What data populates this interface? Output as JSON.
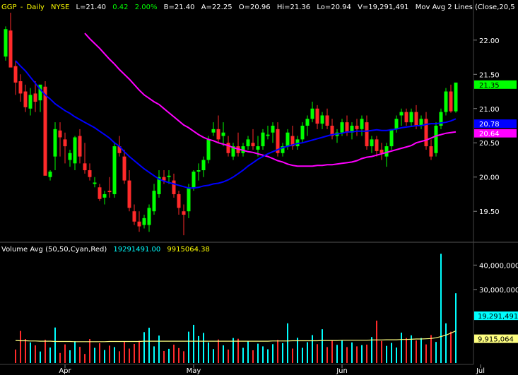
{
  "header": {
    "symbol": "GGP",
    "period": "Daily",
    "exchange": "NYSE",
    "last": "L=21.40",
    "change": "0.42",
    "change_pct": "2.00%",
    "bid": "B=21.40",
    "ask": "A=22.25",
    "open": "O=20.96",
    "high": "Hi=21.36",
    "low": "Lo=20.94",
    "volume": "V=19,291,491",
    "study": "Mov Avg 2 Lines (Close,20,5"
  },
  "volume_header": {
    "label": "Volume Avg (50,50,Cyan,Red)",
    "value1": "19291491.00",
    "value2": "9915064.38"
  },
  "chart_data": [
    {
      "type": "candlestick",
      "title": "GGP - Daily  NYSE",
      "ylim": [
        19.1,
        22.4
      ],
      "yticks": [
        "22.00",
        "21.50",
        "21.00",
        "20.50",
        "20.00",
        "19.50"
      ],
      "ytick_values": [
        22.0,
        21.5,
        21.0,
        20.5,
        20.0,
        19.5
      ],
      "xticks": [
        "Apr",
        "May",
        "Jun",
        "Jul"
      ],
      "xtick_index": [
        12,
        38,
        68,
        96
      ],
      "grid": false,
      "colors": {
        "up": "#00ff00",
        "down": "#ff2a2a",
        "ma_fast": "#0000ff",
        "ma_slow": "#ff00ff"
      },
      "candles": [
        [
          21.76,
          22.2,
          21.7,
          22.16
        ],
        [
          22.14,
          22.4,
          21.85,
          21.6
        ],
        [
          21.62,
          21.7,
          21.2,
          21.38
        ],
        [
          21.4,
          21.5,
          21.1,
          21.22
        ],
        [
          21.25,
          21.35,
          20.95,
          21.02
        ],
        [
          21.0,
          21.3,
          20.9,
          21.2
        ],
        [
          21.22,
          21.4,
          20.95,
          21.1
        ],
        [
          21.12,
          21.25,
          20.95,
          21.35
        ],
        [
          21.32,
          21.4,
          20.6,
          20.02
        ],
        [
          20.0,
          20.1,
          19.95,
          20.08
        ],
        [
          20.3,
          20.8,
          20.1,
          20.7
        ],
        [
          20.68,
          20.8,
          20.3,
          20.58
        ],
        [
          20.55,
          20.65,
          20.2,
          20.45
        ],
        [
          20.25,
          20.4,
          20.15,
          20.35
        ],
        [
          20.2,
          20.6,
          20.1,
          20.58
        ],
        [
          20.6,
          20.7,
          20.2,
          20.3
        ],
        [
          20.2,
          20.5,
          20.05,
          20.1
        ],
        [
          20.1,
          20.2,
          19.95,
          20.0
        ],
        [
          19.9,
          20.0,
          19.85,
          19.92
        ],
        [
          19.85,
          19.9,
          19.65,
          19.68
        ],
        [
          19.7,
          19.8,
          19.6,
          19.75
        ],
        [
          19.8,
          20.0,
          19.7,
          19.78
        ],
        [
          19.75,
          20.5,
          19.7,
          20.45
        ],
        [
          20.45,
          20.6,
          20.3,
          20.35
        ],
        [
          20.3,
          20.4,
          19.9,
          19.95
        ],
        [
          19.95,
          20.1,
          19.5,
          19.55
        ],
        [
          19.5,
          19.6,
          19.3,
          19.35
        ],
        [
          19.35,
          19.5,
          19.2,
          19.28
        ],
        [
          19.3,
          19.45,
          19.25,
          19.4
        ],
        [
          19.3,
          19.6,
          19.2,
          19.55
        ],
        [
          19.5,
          19.9,
          19.45,
          19.8
        ],
        [
          19.75,
          20.1,
          19.7,
          20.0
        ],
        [
          20.0,
          20.1,
          19.9,
          19.95
        ],
        [
          20.0,
          20.1,
          19.9,
          20.02
        ],
        [
          19.95,
          20.05,
          19.7,
          19.75
        ],
        [
          19.75,
          19.8,
          19.45,
          19.55
        ],
        [
          19.5,
          19.6,
          19.15,
          19.45
        ],
        [
          19.5,
          19.9,
          19.4,
          19.85
        ],
        [
          19.85,
          20.1,
          19.8,
          20.08
        ],
        [
          20.08,
          20.2,
          19.95,
          20.1
        ],
        [
          20.1,
          20.3,
          20.0,
          20.25
        ],
        [
          20.25,
          20.6,
          20.2,
          20.55
        ],
        [
          20.65,
          20.8,
          20.6,
          20.7
        ],
        [
          20.7,
          20.9,
          20.5,
          20.55
        ],
        [
          20.6,
          20.8,
          20.45,
          20.65
        ],
        [
          20.5,
          20.6,
          20.3,
          20.35
        ],
        [
          20.3,
          20.5,
          20.25,
          20.45
        ],
        [
          20.45,
          20.65,
          20.3,
          20.35
        ],
        [
          20.35,
          20.5,
          20.3,
          20.45
        ],
        [
          20.45,
          20.6,
          20.4,
          20.55
        ],
        [
          20.5,
          20.7,
          20.4,
          20.45
        ],
        [
          20.4,
          20.6,
          20.3,
          20.45
        ],
        [
          20.45,
          20.7,
          20.4,
          20.65
        ],
        [
          20.6,
          20.75,
          20.55,
          20.62
        ],
        [
          20.65,
          20.8,
          20.5,
          20.75
        ],
        [
          20.7,
          20.8,
          20.3,
          20.35
        ],
        [
          20.35,
          20.5,
          20.3,
          20.45
        ],
        [
          20.45,
          20.7,
          20.4,
          20.65
        ],
        [
          20.6,
          20.75,
          20.4,
          20.45
        ],
        [
          20.45,
          20.6,
          20.4,
          20.55
        ],
        [
          20.55,
          20.8,
          20.5,
          20.75
        ],
        [
          20.75,
          20.9,
          20.6,
          20.85
        ],
        [
          20.85,
          21.1,
          20.8,
          21.0
        ],
        [
          21.0,
          21.05,
          20.7,
          20.78
        ],
        [
          20.78,
          20.95,
          20.7,
          20.9
        ],
        [
          20.9,
          21.0,
          20.7,
          20.75
        ],
        [
          20.75,
          20.85,
          20.55,
          20.6
        ],
        [
          20.6,
          20.7,
          20.5,
          20.65
        ],
        [
          20.65,
          20.85,
          20.6,
          20.8
        ],
        [
          20.8,
          20.9,
          20.6,
          20.65
        ],
        [
          20.65,
          20.8,
          20.55,
          20.75
        ],
        [
          20.75,
          20.85,
          20.6,
          20.7
        ],
        [
          20.7,
          20.9,
          20.6,
          20.85
        ],
        [
          20.8,
          20.9,
          20.4,
          20.45
        ],
        [
          20.45,
          20.6,
          20.35,
          20.55
        ],
        [
          20.55,
          20.6,
          20.3,
          20.38
        ],
        [
          20.4,
          20.5,
          20.25,
          20.35
        ],
        [
          20.3,
          20.5,
          20.15,
          20.45
        ],
        [
          20.45,
          20.7,
          20.4,
          20.7
        ],
        [
          20.7,
          20.9,
          20.65,
          20.85
        ],
        [
          20.9,
          21.0,
          20.75,
          20.95
        ],
        [
          20.95,
          21.0,
          20.75,
          20.8
        ],
        [
          20.8,
          21.0,
          20.75,
          20.95
        ],
        [
          20.95,
          21.05,
          20.7,
          20.75
        ],
        [
          20.75,
          20.9,
          20.7,
          20.85
        ],
        [
          20.85,
          20.95,
          20.4,
          20.45
        ],
        [
          20.45,
          20.55,
          20.25,
          20.3
        ],
        [
          20.35,
          20.8,
          20.3,
          20.75
        ],
        [
          20.75,
          21.0,
          20.7,
          20.95
        ],
        [
          20.95,
          21.3,
          20.9,
          21.25
        ],
        [
          21.25,
          21.35,
          20.94,
          20.96
        ],
        [
          20.96,
          21.36,
          20.94,
          21.38
        ]
      ],
      "ma_fast": [
        21.7,
        21.62,
        21.55,
        21.46,
        21.37,
        21.28,
        21.2,
        21.14,
        21.07,
        21.02,
        20.97,
        20.93,
        20.88,
        20.84,
        20.8,
        20.76,
        20.72,
        20.67,
        20.62,
        20.57,
        20.5,
        20.45,
        20.37,
        20.3,
        20.24,
        20.18,
        20.12,
        20.07,
        20.02,
        19.97,
        19.94,
        19.92,
        19.9,
        19.88,
        19.86,
        19.84,
        19.84,
        19.85,
        19.87,
        19.88,
        19.9,
        19.91,
        19.93,
        19.96,
        20.0,
        20.05,
        20.1,
        20.16,
        20.21,
        20.26,
        20.3,
        20.34,
        20.37,
        20.4,
        20.43,
        20.45,
        20.47,
        20.49,
        20.5,
        20.52,
        20.54,
        20.56,
        20.58,
        20.6,
        20.62,
        20.63,
        20.64,
        20.66,
        20.66,
        20.67,
        20.67,
        20.67,
        20.68,
        20.69,
        20.68,
        20.68,
        20.69,
        20.7,
        20.72,
        20.73,
        20.74,
        20.75,
        20.75,
        20.77,
        20.78,
        20.78,
        20.79,
        20.8,
        20.82,
        20.85
      ],
      "ma_slow": [
        22.1,
        22.02,
        21.95,
        21.88,
        21.8,
        21.72,
        21.65,
        21.57,
        21.5,
        21.43,
        21.35,
        21.27,
        21.2,
        21.15,
        21.1,
        21.06,
        21.0,
        20.94,
        20.88,
        20.82,
        20.76,
        20.72,
        20.67,
        20.62,
        20.58,
        20.55,
        20.53,
        20.5,
        20.48,
        20.46,
        20.43,
        20.41,
        20.39,
        20.37,
        20.36,
        20.34,
        20.32,
        20.3,
        20.27,
        20.24,
        20.22,
        20.19,
        20.17,
        20.16,
        20.16,
        20.16,
        20.16,
        20.17,
        20.17,
        20.18,
        20.18,
        20.19,
        20.2,
        20.21,
        20.22,
        20.24,
        20.27,
        20.29,
        20.3,
        20.32,
        20.34,
        20.36,
        20.38,
        20.4,
        20.42,
        20.44,
        20.46,
        20.5,
        20.52,
        20.54,
        20.57,
        20.6,
        20.62,
        20.64,
        20.65,
        20.66
      ],
      "last_labels": [
        {
          "text": "21.35",
          "value": 21.35,
          "color": "#00ff00"
        },
        {
          "text": "20.78",
          "value": 20.78,
          "color": "#0000ff"
        },
        {
          "text": "20.64",
          "value": 20.64,
          "color": "#ff00ff"
        }
      ]
    },
    {
      "type": "bar",
      "title": "Volume Avg (50,50,Cyan,Red)",
      "ylim": [
        0,
        45000000
      ],
      "yticks": [
        "40,000,000",
        "30,000,000"
      ],
      "ytick_values": [
        40000000,
        30000000
      ],
      "volume": [
        5.5,
        13.1,
        9.8,
        8.4,
        7.2,
        4.7,
        9.5,
        6.3,
        14.5,
        4.1,
        7.6,
        5.2,
        8.9,
        6.6,
        3.7,
        9.8,
        6.2,
        8.1,
        5.3,
        7.1,
        6.5,
        4.8,
        8.8,
        5.9,
        7.8,
        9.1,
        12.6,
        14.4,
        6.8,
        11.2,
        4.9,
        5.8,
        7.5,
        6.1,
        4.8,
        12.8,
        15.6,
        11.0,
        12.3,
        8.4,
        5.7,
        9.6,
        7.2,
        5.5,
        10.2,
        9.9,
        6.2,
        8.8,
        5.2,
        7.9,
        6.8,
        5.6,
        7.7,
        9.4,
        8.1,
        16.2,
        5.9,
        10.3,
        6.2,
        8.5,
        11.4,
        7.7,
        13.8,
        6.5,
        9.1,
        7.4,
        9.2,
        6.5,
        8.4,
        6.8,
        7.3,
        7.5,
        10.6,
        17.3,
        9.0,
        7.0,
        8.2,
        6.3,
        12.4,
        10.2,
        11.3,
        9.2,
        10.2,
        7.6,
        11.4,
        8.6,
        44.6,
        16.2,
        12.8,
        28.5
      ],
      "avg": [
        9.2,
        9.1,
        9.1,
        9.0,
        9.0,
        8.9,
        8.9,
        8.9,
        8.8,
        8.8,
        8.8,
        8.8,
        8.7,
        8.7,
        8.7,
        8.7,
        8.7,
        8.7,
        8.7,
        8.8,
        8.8,
        8.8,
        8.8,
        8.8,
        8.8,
        8.8,
        8.9,
        8.9,
        8.9,
        8.9,
        8.9,
        8.9,
        8.9,
        8.9,
        8.9,
        8.9,
        8.9,
        8.9,
        8.9,
        8.9,
        8.9,
        8.9,
        8.9,
        8.9,
        8.9,
        8.9,
        8.9,
        8.9,
        8.9,
        8.9,
        8.9,
        8.9,
        9.0,
        9.0,
        9.0,
        9.0,
        9.1,
        9.1,
        9.1,
        9.1,
        9.1,
        9.1,
        9.2,
        9.2,
        9.2,
        9.2,
        9.3,
        9.3,
        9.3,
        9.3,
        9.3,
        9.3,
        9.4,
        9.4,
        9.4,
        9.5,
        9.5,
        9.5,
        9.6,
        9.6,
        9.7,
        9.8,
        9.8,
        9.9,
        10.0,
        10.3,
        10.8,
        11.4,
        12.2,
        13.1
      ],
      "volume_unit": "millions",
      "colors": {
        "up": "#00ffff",
        "down": "#ff2a2a",
        "avg": "#ffff80"
      },
      "last_labels": [
        {
          "text": "19,291,491",
          "value": 19291491,
          "color": "#00ffff"
        },
        {
          "text": "9,915,064",
          "value": 9915064,
          "color": "#ffff80"
        }
      ]
    }
  ]
}
